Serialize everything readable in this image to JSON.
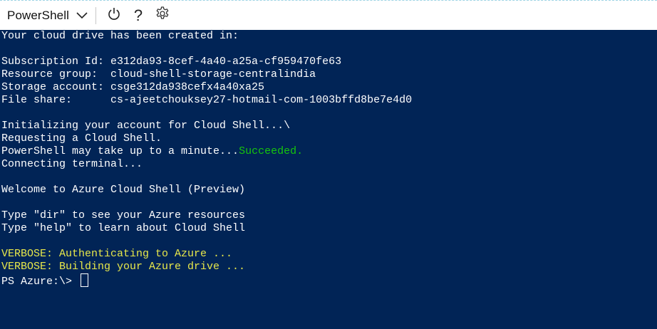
{
  "toolbar": {
    "shell_label": "PowerShell",
    "icons": [
      "chevron-down-icon",
      "power-icon",
      "help-icon",
      "gear-icon"
    ],
    "help_glyph": "?"
  },
  "terminal": {
    "lines": [
      "Your cloud drive has been created in:",
      "",
      "Subscription Id: e312da93-8cef-4a40-a25a-cf959470fe63",
      "Resource group:  cloud-shell-storage-centralindia",
      "Storage account: csge312da938cefx4a40xa25",
      "File share:      cs-ajeetchouksey27-hotmail-com-1003bffd8be7e4d0",
      "",
      "Initializing your account for Cloud Shell...\\",
      "Requesting a Cloud Shell.",
      "PowerShell may take up to a minute...",
      "Connecting terminal...",
      "",
      "Welcome to Azure Cloud Shell (Preview)",
      "",
      "Type \"dir\" to see your Azure resources",
      "Type \"help\" to learn about Cloud Shell",
      "",
      "VERBOSE: Authenticating to Azure ...",
      "VERBOSE: Building your Azure drive ...",
      "PS Azure:\\> "
    ],
    "succeeded_text": "Succeeded.",
    "colors": {
      "background": "#012456",
      "text": "#ffffff",
      "success": "#16c60c",
      "verbose": "#e8e84a"
    }
  }
}
